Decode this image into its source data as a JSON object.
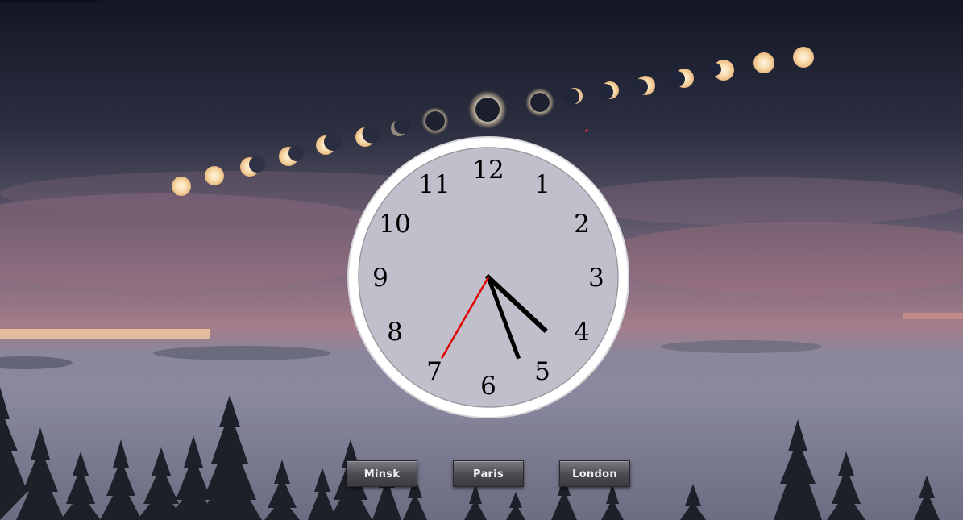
{
  "clock": {
    "numerals": [
      "12",
      "1",
      "2",
      "3",
      "4",
      "5",
      "6",
      "7",
      "8",
      "9",
      "10",
      "11"
    ],
    "time": {
      "hour": 4,
      "minute": 26,
      "second": 35
    },
    "colors": {
      "face_ring": "#ffffff",
      "hour_hand": "#000000",
      "minute_hand": "#000000",
      "second_hand": "#e00000",
      "numerals": "#000000"
    }
  },
  "buttons": {
    "minsk": "Minsk",
    "paris": "Paris",
    "london": "London"
  },
  "background": {
    "sky_top": "#151a27",
    "sky_mid": "#5a5468",
    "horizon_glow": "#f2b48c",
    "fog": "#8c8aa0",
    "trees": "#1c2028"
  }
}
